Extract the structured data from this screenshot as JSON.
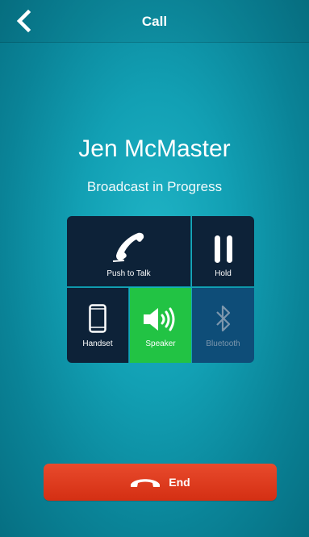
{
  "nav": {
    "title": "Call",
    "back_icon": "chevron-left-icon"
  },
  "call": {
    "contact_name": "Jen McMaster",
    "status": "Broadcast in Progress"
  },
  "controls": [
    {
      "id": "push-to-talk",
      "label": "Push to Talk",
      "icon": "phone-handset-icon"
    },
    {
      "id": "hold",
      "label": "Hold",
      "icon": "pause-icon"
    },
    {
      "id": "handset",
      "label": "Handset",
      "icon": "mobile-phone-icon"
    },
    {
      "id": "speaker",
      "label": "Speaker",
      "icon": "speaker-icon",
      "active": true
    },
    {
      "id": "bluetooth",
      "label": "Bluetooth",
      "icon": "bluetooth-icon",
      "disabled": true
    }
  ],
  "end_button": {
    "label": "End",
    "icon": "hang-up-icon"
  },
  "colors": {
    "background": "#12a0b4",
    "tile": "#0d2238",
    "speaker_active": "#22c344",
    "bluetooth_disabled": "#0e4d78",
    "end": "#d42f13"
  }
}
